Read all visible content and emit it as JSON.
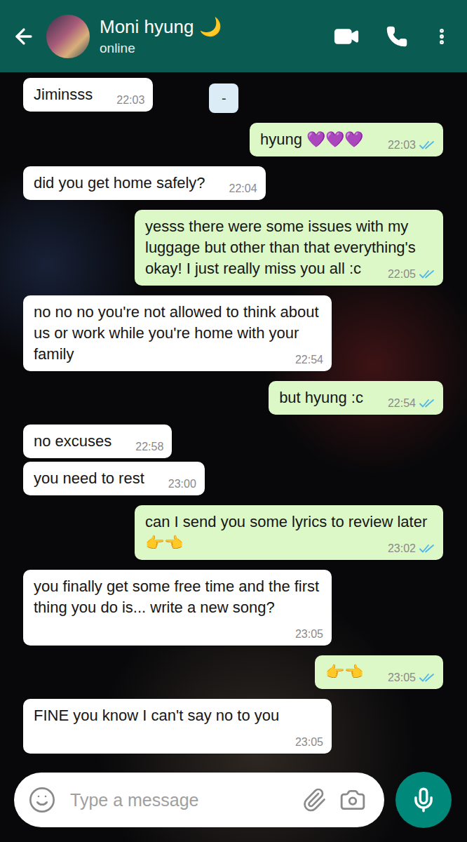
{
  "chat": {
    "contact": "Moni hyung 🌙",
    "status": "online"
  },
  "chip": {
    "text": "-"
  },
  "messages": [
    {
      "kind": "incoming",
      "text": "Jiminsss",
      "time": "22:03",
      "read_ticks": false
    },
    {
      "kind": "outgoing",
      "text": "hyung 💜💜💜",
      "time": "22:03",
      "read_ticks": true
    },
    {
      "kind": "incoming",
      "text": "did you get home safely?",
      "time": "22:04",
      "read_ticks": false
    },
    {
      "kind": "outgoing",
      "text": "yesss there were some issues with my luggage but other than that everything's okay! I just really miss you all :c",
      "time": "22:05",
      "read_ticks": true
    },
    {
      "kind": "incoming",
      "text": "no no no you're not allowed to think about us or work while you're home with your family",
      "time": "22:54",
      "read_ticks": false
    },
    {
      "kind": "outgoing",
      "text": "but hyung :c",
      "time": "22:54",
      "read_ticks": true
    },
    {
      "kind": "incoming",
      "text": "no excuses",
      "time": "22:58",
      "read_ticks": false
    },
    {
      "kind": "incoming",
      "text": "you need to rest",
      "time": "23:00",
      "read_ticks": false
    },
    {
      "kind": "outgoing",
      "text": "can I send you some lyrics to review later 👉👈",
      "time": "23:02",
      "read_ticks": true
    },
    {
      "kind": "incoming",
      "text": "you finally get some free time and the first thing you do is... write a new song?",
      "time": "23:05",
      "read_ticks": false
    },
    {
      "kind": "outgoing",
      "text": "👉👈",
      "time": "23:05",
      "read_ticks": true
    },
    {
      "kind": "incoming",
      "text": "FINE you know I can't say no to you",
      "time": "23:05",
      "read_ticks": false
    }
  ],
  "composer": {
    "placeholder": "Type a message"
  }
}
